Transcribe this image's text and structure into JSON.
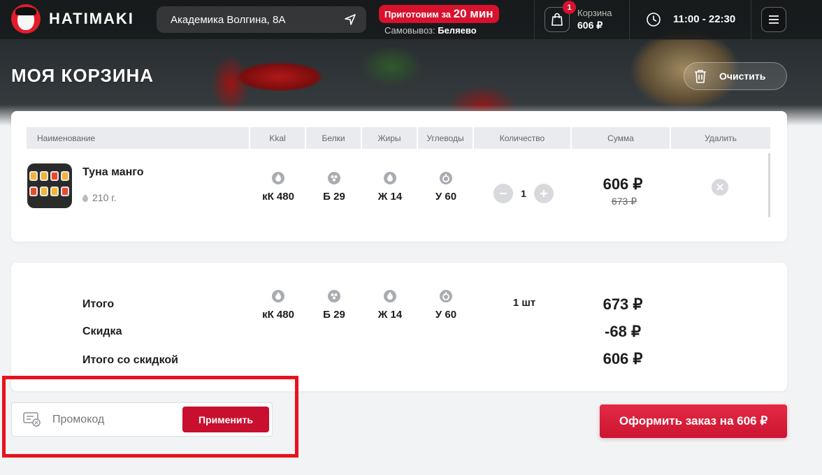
{
  "header": {
    "logo_text": "HATIMAKI",
    "address": "Академика Волгина, 8А",
    "cook_prefix": "Приготовим за ",
    "cook_time": "20 мин",
    "pickup_label": "Самовывоз:",
    "pickup_location": "Беляево",
    "cart_count": "1",
    "cart_label": "Корзина",
    "cart_sum": "606 ₽",
    "hours": "11:00 - 22:30"
  },
  "page": {
    "title": "МОЯ КОРЗИНА",
    "clear_label": "Очистить"
  },
  "table": {
    "columns": [
      "Наименование",
      "Kkal",
      "Белки",
      "Жиры",
      "Углеводы",
      "Количество",
      "Сумма",
      "Удалить"
    ]
  },
  "item": {
    "name": "Туна манго",
    "weight": "210 г.",
    "kcal": "кК 480",
    "protein": "Б 29",
    "fat": "Ж 14",
    "carbs": "У 60",
    "quantity": "1",
    "price": "606 ₽",
    "old_price": "673 ₽"
  },
  "summary": {
    "total_label": "Итого",
    "discount_label": "Скидка",
    "final_label": "Итого со скидкой",
    "kcal": "кК 480",
    "protein": "Б 29",
    "fat": "Ж 14",
    "carbs": "У 60",
    "qty": "1 шт",
    "total": "673 ₽",
    "discount": "-68 ₽",
    "final": "606 ₽"
  },
  "promo": {
    "placeholder": "Промокод",
    "apply_label": "Применить"
  },
  "checkout": {
    "label": "Оформить заказ на 606 ₽"
  },
  "colors": {
    "accent": "#d8112d",
    "highlight": "#e8111c"
  }
}
